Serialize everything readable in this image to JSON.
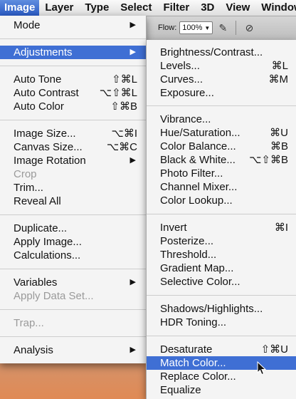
{
  "menubar": {
    "items": [
      "Image",
      "Layer",
      "Type",
      "Select",
      "Filter",
      "3D",
      "View",
      "Window"
    ]
  },
  "toolbar": {
    "flow_label": "Flow:",
    "flow_value": "100%"
  },
  "image_menu": {
    "mode": "Mode",
    "adjustments": "Adjustments",
    "auto_tone": "Auto Tone",
    "auto_tone_sc": "⇧⌘L",
    "auto_contrast": "Auto Contrast",
    "auto_contrast_sc": "⌥⇧⌘L",
    "auto_color": "Auto Color",
    "auto_color_sc": "⇧⌘B",
    "image_size": "Image Size...",
    "image_size_sc": "⌥⌘I",
    "canvas_size": "Canvas Size...",
    "canvas_size_sc": "⌥⌘C",
    "image_rotation": "Image Rotation",
    "crop": "Crop",
    "trim": "Trim...",
    "reveal_all": "Reveal All",
    "duplicate": "Duplicate...",
    "apply_image": "Apply Image...",
    "calculations": "Calculations...",
    "variables": "Variables",
    "apply_data_set": "Apply Data Set...",
    "trap": "Trap...",
    "analysis": "Analysis"
  },
  "adjustments_menu": {
    "brightness_contrast": "Brightness/Contrast...",
    "levels": "Levels...",
    "levels_sc": "⌘L",
    "curves": "Curves...",
    "curves_sc": "⌘M",
    "exposure": "Exposure...",
    "vibrance": "Vibrance...",
    "hue_saturation": "Hue/Saturation...",
    "hue_saturation_sc": "⌘U",
    "color_balance": "Color Balance...",
    "color_balance_sc": "⌘B",
    "black_white": "Black & White...",
    "black_white_sc": "⌥⇧⌘B",
    "photo_filter": "Photo Filter...",
    "channel_mixer": "Channel Mixer...",
    "color_lookup": "Color Lookup...",
    "invert": "Invert",
    "invert_sc": "⌘I",
    "posterize": "Posterize...",
    "threshold": "Threshold...",
    "gradient_map": "Gradient Map...",
    "selective_color": "Selective Color...",
    "shadows_highlights": "Shadows/Highlights...",
    "hdr_toning": "HDR Toning...",
    "desaturate": "Desaturate",
    "desaturate_sc": "⇧⌘U",
    "match_color": "Match Color...",
    "replace_color": "Replace Color...",
    "equalize": "Equalize"
  },
  "colors": {
    "highlight": "#3f6fd4",
    "menu_bg": "#f4f4f4"
  }
}
